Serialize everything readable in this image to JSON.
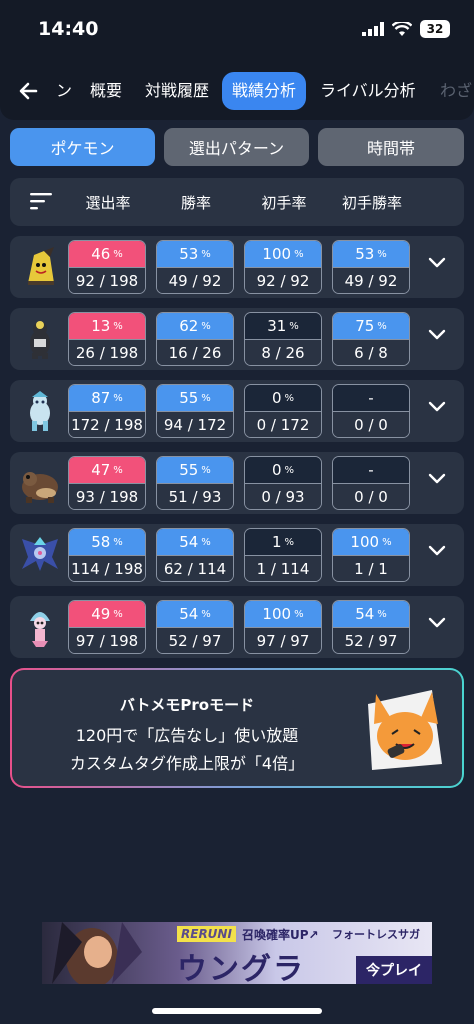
{
  "status_bar": {
    "time": "14:40",
    "battery": "32"
  },
  "tabs": [
    {
      "label": "ン",
      "faded": false
    },
    {
      "label": "概要",
      "faded": false
    },
    {
      "label": "対戦履歴",
      "faded": false
    },
    {
      "label": "戦績分析",
      "active": true
    },
    {
      "label": "ライバル分析",
      "faded": false
    },
    {
      "label": "わざ",
      "faded": true
    }
  ],
  "segments": [
    {
      "label": "ポケモン",
      "selected": true
    },
    {
      "label": "選出パターン",
      "selected": false
    },
    {
      "label": "時間帯",
      "selected": false
    }
  ],
  "columns": [
    "選出率",
    "勝率",
    "初手率",
    "初手勝率"
  ],
  "unit": "%",
  "rows": [
    {
      "pokemon": "mimikyu-icon",
      "cells": [
        {
          "pct": "46",
          "frac": "92 / 198",
          "tone": "pink"
        },
        {
          "pct": "53",
          "frac": "49 / 92",
          "tone": "blue"
        },
        {
          "pct": "100",
          "frac": "92 / 92",
          "tone": "blue"
        },
        {
          "pct": "53",
          "frac": "49 / 92",
          "tone": "blue"
        }
      ]
    },
    {
      "pokemon": "urshifu-icon",
      "cells": [
        {
          "pct": "13",
          "frac": "26 / 198",
          "tone": "pink"
        },
        {
          "pct": "62",
          "frac": "16 / 26",
          "tone": "blue"
        },
        {
          "pct": "31",
          "frac": "8 / 26",
          "tone": "navy"
        },
        {
          "pct": "75",
          "frac": "6 / 8",
          "tone": "blue"
        }
      ]
    },
    {
      "pokemon": "calyrex-ice-icon",
      "cells": [
        {
          "pct": "87",
          "frac": "172 / 198",
          "tone": "blue"
        },
        {
          "pct": "55",
          "frac": "94 / 172",
          "tone": "blue"
        },
        {
          "pct": "0",
          "frac": "0 / 172",
          "tone": "navy"
        },
        {
          "pct": "-",
          "frac": "0 / 0",
          "tone": "navy"
        }
      ]
    },
    {
      "pokemon": "ursaluna-icon",
      "cells": [
        {
          "pct": "47",
          "frac": "93 / 198",
          "tone": "pink"
        },
        {
          "pct": "55",
          "frac": "51 / 93",
          "tone": "blue"
        },
        {
          "pct": "0",
          "frac": "0 / 93",
          "tone": "navy"
        },
        {
          "pct": "-",
          "frac": "0 / 0",
          "tone": "navy"
        }
      ]
    },
    {
      "pokemon": "lunala-icon",
      "cells": [
        {
          "pct": "58",
          "frac": "114 / 198",
          "tone": "blue"
        },
        {
          "pct": "54",
          "frac": "62 / 114",
          "tone": "blue"
        },
        {
          "pct": "1",
          "frac": "1 / 114",
          "tone": "navy"
        },
        {
          "pct": "100",
          "frac": "1 / 1",
          "tone": "blue"
        }
      ]
    },
    {
      "pokemon": "hatterene-icon",
      "cells": [
        {
          "pct": "49",
          "frac": "97 / 198",
          "tone": "pink"
        },
        {
          "pct": "54",
          "frac": "52 / 97",
          "tone": "blue"
        },
        {
          "pct": "100",
          "frac": "97 / 97",
          "tone": "blue"
        },
        {
          "pct": "54",
          "frac": "52 / 97",
          "tone": "blue"
        }
      ]
    }
  ],
  "promo": {
    "title": "バトメモProモード",
    "line1": "120円で「広告なし」使い放題",
    "line2": "カスタムタグ作成上限が「4倍」"
  },
  "ad": {
    "logo": "RERUNI",
    "tag": "召喚確率UP↗",
    "title": "ウングラ",
    "brand": "フォートレスサガ",
    "cta": "今プレイ"
  },
  "colors": {
    "pink": "#f2517a",
    "blue": "#4a95ee",
    "navy": "#1b2638",
    "panel": "#2a3343",
    "bg": "#1a2233"
  }
}
